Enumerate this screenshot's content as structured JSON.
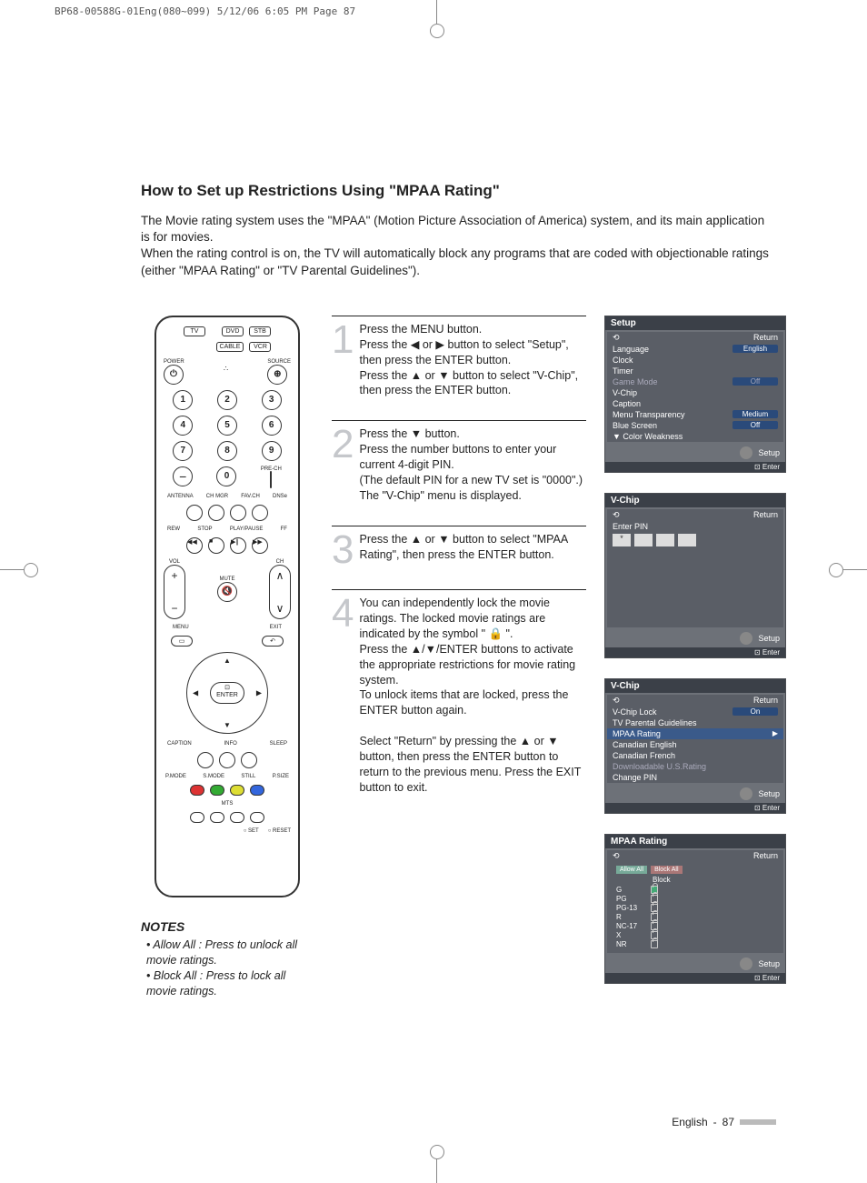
{
  "header_meta": "BP68-00588G-01Eng(080~099)  5/12/06  6:05 PM  Page 87",
  "title": "How to Set up Restrictions Using \"MPAA Rating\"",
  "intro": "The Movie rating system uses the \"MPAA\" (Motion Picture Association of America) system, and its main application is for movies.\nWhen the rating control is on, the TV will automatically block any programs that are coded with objectionable ratings (either \"MPAA Rating\" or \"TV Parental Guidelines\").",
  "remote": {
    "tv": "TV",
    "dvd": "DVD",
    "stb": "STB",
    "cable": "CABLE",
    "vcr": "VCR",
    "power": "POWER",
    "source": "SOURCE",
    "nums": [
      "1",
      "2",
      "3",
      "4",
      "5",
      "6",
      "7",
      "8",
      "9",
      "0"
    ],
    "prech": "PRE-CH",
    "labels": {
      "antenna": "ANTENNA",
      "chmgr": "CH MGR",
      "favch": "FAV.CH",
      "dnse": "DNSe",
      "rew": "REW",
      "stop": "STOP",
      "play": "PLAY/PAUSE",
      "ff": "FF",
      "vol": "VOL",
      "ch": "CH",
      "mute": "MUTE",
      "menu": "MENU",
      "exit": "EXIT",
      "enter": "ENTER",
      "caption": "CAPTION",
      "info": "INFO",
      "sleep": "SLEEP",
      "pmode": "P.MODE",
      "smode": "S.MODE",
      "still": "STILL",
      "psize": "P.SIZE",
      "mts": "MTS",
      "set": "SET",
      "reset": "RESET"
    }
  },
  "notes": {
    "heading": "NOTES",
    "items": [
      "Allow All : Press to unlock all movie ratings.",
      "Block All : Press to lock all movie ratings."
    ]
  },
  "steps": [
    {
      "n": "1",
      "body": "Press the MENU button.\nPress the ◀ or ▶ button to select \"Setup\", then press  the ENTER button.\nPress the ▲ or ▼ button to select \"V-Chip\", then press the ENTER button."
    },
    {
      "n": "2",
      "body": "Press the ▼ button.\nPress the number buttons to enter your current 4-digit PIN.\n(The default PIN for a new TV set is \"0000\".)\nThe \"V-Chip\" menu is displayed."
    },
    {
      "n": "3",
      "body": "Press the ▲ or ▼ button to select \"MPAA Rating\", then press the ENTER button."
    },
    {
      "n": "4",
      "body": "You can independently lock the movie ratings. The locked movie ratings are indicated by the symbol \" 🔒 \".\nPress the ▲/▼/ENTER buttons to activate the appropriate restrictions for movie rating system.\nTo unlock items that are locked, press the ENTER button again.\n\nSelect \"Return\" by pressing the ▲ or ▼ button, then press the ENTER button to return to the previous menu. Press the EXIT button to exit."
    }
  ],
  "menus": {
    "setup": {
      "title": "Setup",
      "return": "Return",
      "items": [
        {
          "label": "Language",
          "value": "English",
          "sel": true
        },
        {
          "label": "Clock"
        },
        {
          "label": "Timer"
        },
        {
          "label": "Game Mode",
          "value": "Off",
          "dim": true
        },
        {
          "label": "V-Chip"
        },
        {
          "label": "Caption"
        },
        {
          "label": "Menu Transparency",
          "value": "Medium"
        },
        {
          "label": "Blue Screen",
          "value": "Off"
        },
        {
          "label": "▼ Color Weakness",
          "noval": true
        }
      ],
      "footer": "Setup",
      "enter": "Enter"
    },
    "vchip_pin": {
      "title": "V-Chip",
      "return": "Return",
      "enter_pin": "Enter PIN",
      "footer": "Setup",
      "enter": "Enter"
    },
    "vchip_menu": {
      "title": "V-Chip",
      "return": "Return",
      "items": [
        {
          "label": "V-Chip Lock",
          "value": "On"
        },
        {
          "label": "TV Parental Guidelines"
        },
        {
          "label": "MPAA Rating",
          "sel": true,
          "arrow": true
        },
        {
          "label": "Canadian English"
        },
        {
          "label": "Canadian French"
        },
        {
          "label": "Downloadable U.S.Rating",
          "dim": true
        },
        {
          "label": "Change PIN"
        }
      ],
      "footer": "Setup",
      "enter": "Enter"
    },
    "mpaa": {
      "title": "MPAA Rating",
      "return": "Return",
      "allow": "Allow All",
      "block": "Block All",
      "col": "Block",
      "ratings": [
        "G",
        "PG",
        "PG-13",
        "R",
        "NC-17",
        "X",
        "NR"
      ],
      "footer": "Setup",
      "enter": "Enter"
    }
  },
  "footer": {
    "lang": "English",
    "page": "87"
  }
}
